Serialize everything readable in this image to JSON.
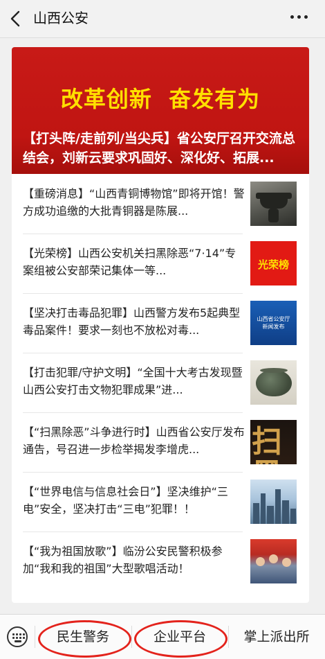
{
  "header": {
    "title": "山西公安",
    "back_icon": "chevron-left-icon",
    "more_icon": "more-horizontal-icon"
  },
  "banner": {
    "slogan": "改革创新  奋发有为",
    "caption": "【打头阵/走前列/当尖兵】省公安厅召开交流总结会，刘新云要求巩固好、深化好、拓展...",
    "colors": {
      "background": "#c81a17",
      "slogan": "#ffe000"
    }
  },
  "news": [
    {
      "text": "【重磅消息】“山西青铜博物馆”即将开馆！警方成功追缴的大批青铜器是陈展...",
      "thumb": "bronze-vessel-image"
    },
    {
      "text": "【光荣榜】山西公安机关扫黑除恶“7·14”专案组被公安部荣记集体一等...",
      "thumb": "honor-roll-image",
      "thumb_text": "光荣榜"
    },
    {
      "text": "【坚决打击毒品犯罪】山西警方发布5起典型毒品案件！要求一刻也不放松对毒...",
      "thumb": "press-release-image",
      "thumb_lines": [
        "山西省公安厅",
        "新闻发布"
      ]
    },
    {
      "text": "【打击犯罪/守护文明】“全国十大考古发现暨山西公安打击文物犯罪成果”进...",
      "thumb": "bronze-artifact-image"
    },
    {
      "text": "【“扫黑除恶”斗争进行时】山西省公安厅发布通告，号召进一步检举揭发李增虎...",
      "thumb": "calligraphy-image",
      "thumb_text": "扫黑"
    },
    {
      "text": "【“世界电信与信息社会日”】坚决维护“三电”安全，坚决打击“三电”犯罪！！",
      "thumb": "city-skyline-image"
    },
    {
      "text": "【“我为祖国放歌”】临汾公安民警积极参加“我和我的祖国”大型歌唱活动！",
      "thumb": "singing-police-image"
    }
  ],
  "bottom_menu": {
    "keyboard_icon": "keyboard-icon",
    "items": [
      "民生警务",
      "企业平台",
      "掌上派出所"
    ],
    "highlight_color": "#e3231c"
  }
}
